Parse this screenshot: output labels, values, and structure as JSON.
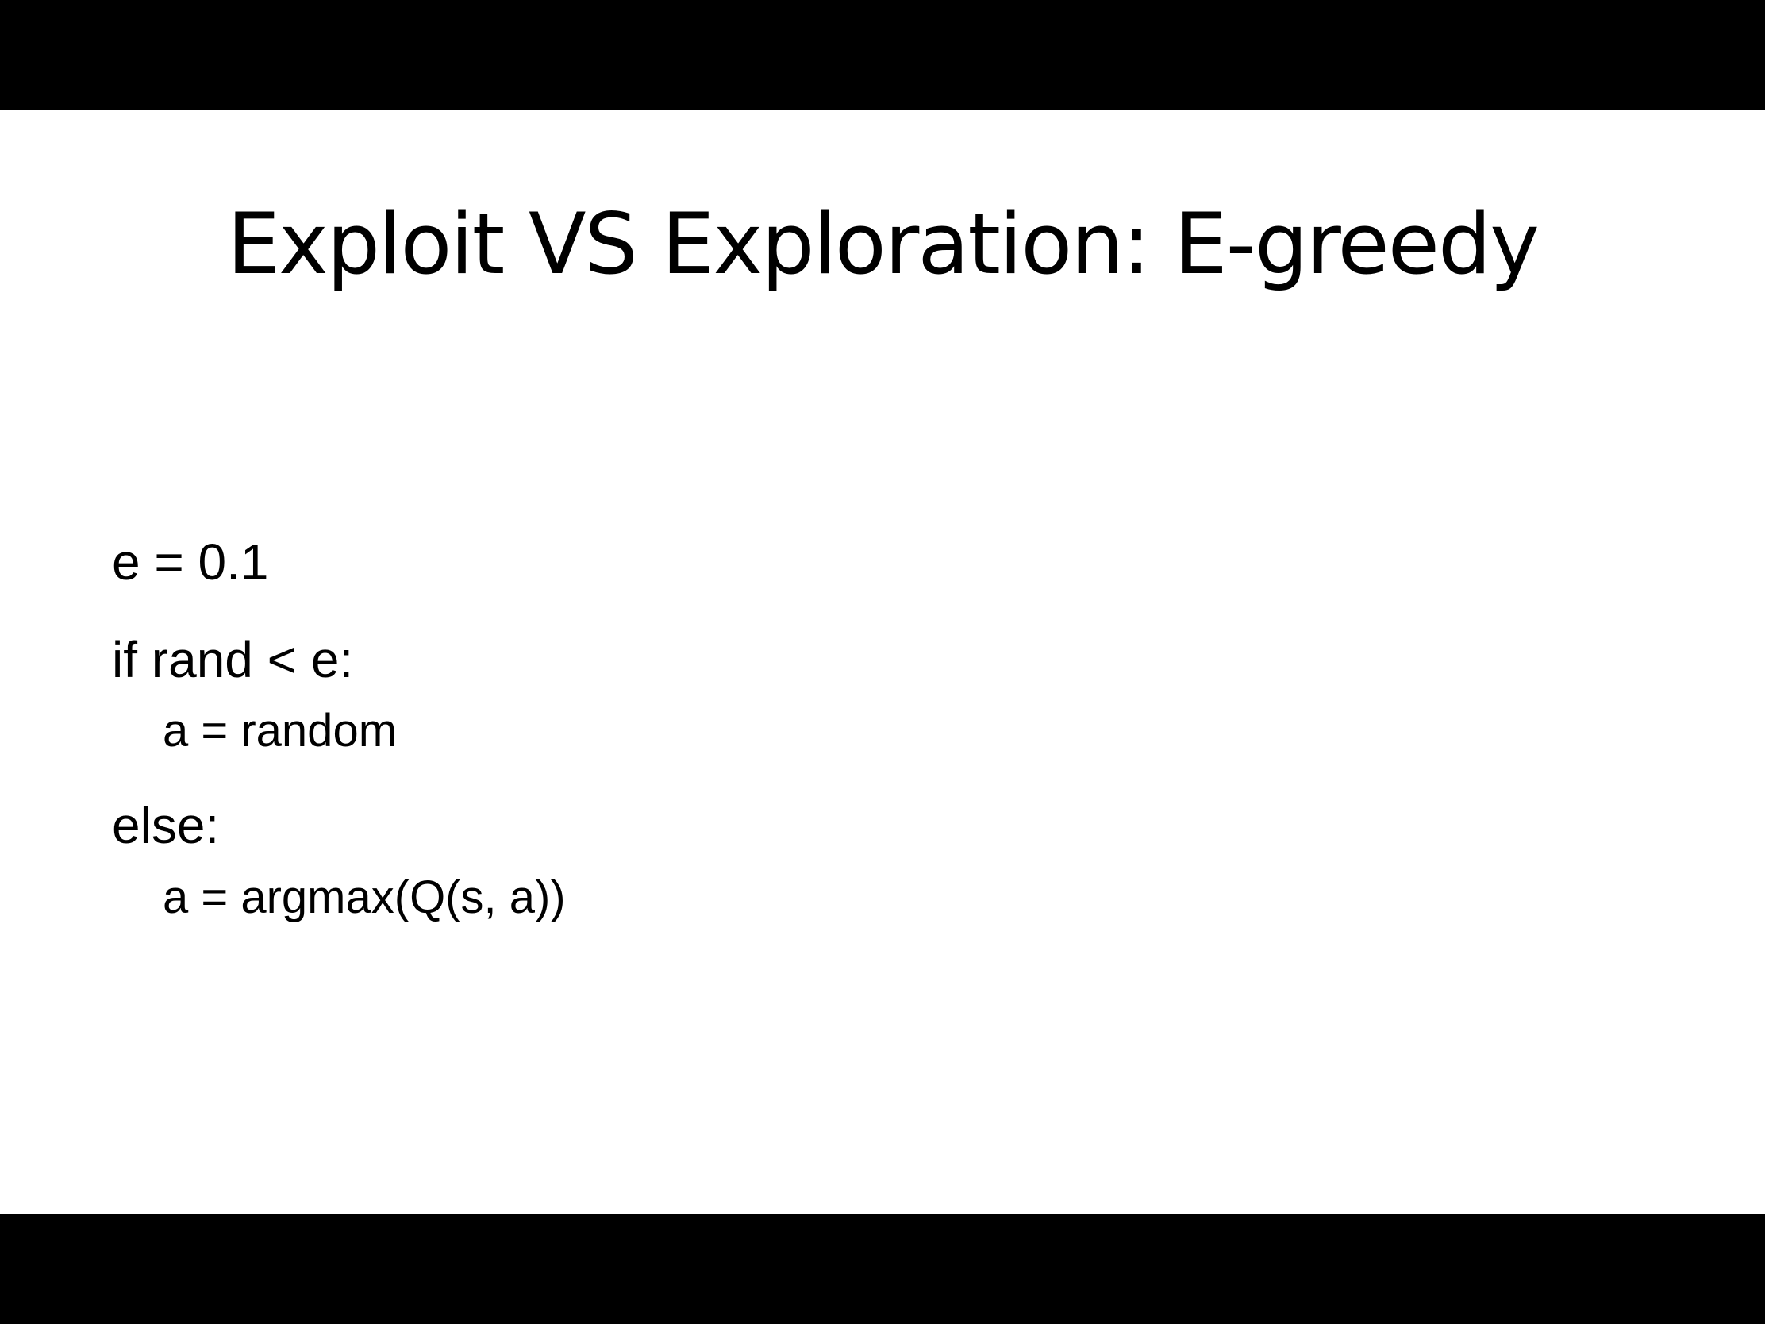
{
  "slide": {
    "title": "Exploit VS Exploration: E-greedy",
    "code_lines": [
      {
        "text": "e = 0.1",
        "indent": 0
      },
      {
        "text": "if rand < e:",
        "indent": 0
      },
      {
        "text": "a = random",
        "indent": 1
      },
      {
        "text": "else:",
        "indent": 0
      },
      {
        "text": "a = argmax(Q(s, a))",
        "indent": 1
      }
    ]
  },
  "colors": {
    "background": "#ffffff",
    "letterbox": "#000000",
    "text": "#000000"
  }
}
